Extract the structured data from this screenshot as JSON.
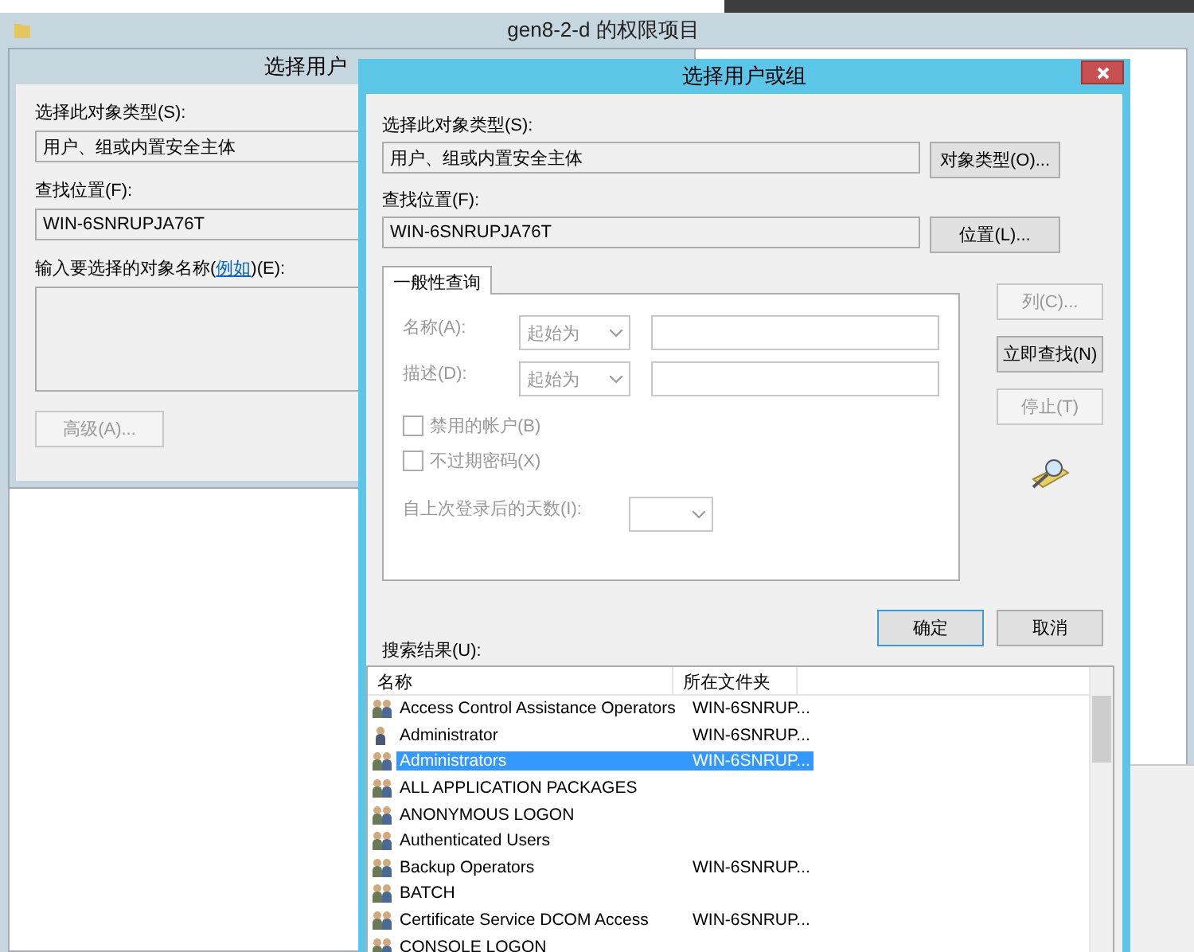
{
  "window": {
    "title": "gen8-2-d 的权限项目"
  },
  "back_dialog": {
    "title": "选择用户",
    "object_type_label": "选择此对象类型(S):",
    "object_type_value": "用户、组或内置安全主体",
    "location_label": "查找位置(F):",
    "location_value": "WIN-6SNRUPJA76T",
    "names_label_before": "输入要选择的对象名称(",
    "names_link": "例如",
    "names_label_after": ")(E):",
    "advanced_button": {
      "label": "高级(A)...",
      "disabled": true
    }
  },
  "dialog": {
    "title": "选择用户或组",
    "object_type_label": "选择此对象类型(S):",
    "object_type_value": "用户、组或内置安全主体",
    "object_type_button": "对象类型(O)...",
    "location_label": "查找位置(F):",
    "location_value": "WIN-6SNRUPJA76T",
    "location_button": "位置(L)...",
    "tabs": [
      {
        "label": "一般性查询",
        "selected": true
      }
    ],
    "query": {
      "name_label": "名称(A):",
      "name_mode": "起始为",
      "description_label": "描述(D):",
      "description_mode": "起始为",
      "checkboxes": [
        {
          "label": "禁用的帐户(B)",
          "checked": false
        },
        {
          "label": "不过期密码(X)",
          "checked": false
        }
      ],
      "days_label": "自上次登录后的天数(I):"
    },
    "side_buttons": [
      {
        "label": "列(C)...",
        "disabled": true
      },
      {
        "label": "立即查找(N)",
        "disabled": false
      },
      {
        "label": "停止(T)",
        "disabled": true
      }
    ],
    "ok_button": "确定",
    "cancel_button": "取消",
    "results_label": "搜索结果(U):",
    "results": {
      "columns": [
        "名称",
        "所在文件夹"
      ],
      "rows": [
        {
          "kind": "group",
          "name": "Access Control Assistance Operators",
          "folder": "WIN-6SNRUP...",
          "selected": false
        },
        {
          "kind": "user",
          "name": "Administrator",
          "folder": "WIN-6SNRUP...",
          "selected": false
        },
        {
          "kind": "group",
          "name": "Administrators",
          "folder": "WIN-6SNRUP...",
          "selected": true
        },
        {
          "kind": "group",
          "name": "ALL APPLICATION PACKAGES",
          "selected": false
        },
        {
          "kind": "group",
          "name": "ANONYMOUS LOGON",
          "selected": false
        },
        {
          "kind": "group",
          "name": "Authenticated Users",
          "selected": false
        },
        {
          "kind": "group",
          "name": "Backup Operators",
          "folder": "WIN-6SNRUP...",
          "selected": false
        },
        {
          "kind": "group",
          "name": "BATCH",
          "selected": false
        },
        {
          "kind": "group",
          "name": "Certificate Service DCOM Access",
          "folder": "WIN-6SNRUP...",
          "selected": false
        },
        {
          "kind": "group",
          "name": "CONSOLE LOGON",
          "selected": false
        }
      ]
    }
  }
}
